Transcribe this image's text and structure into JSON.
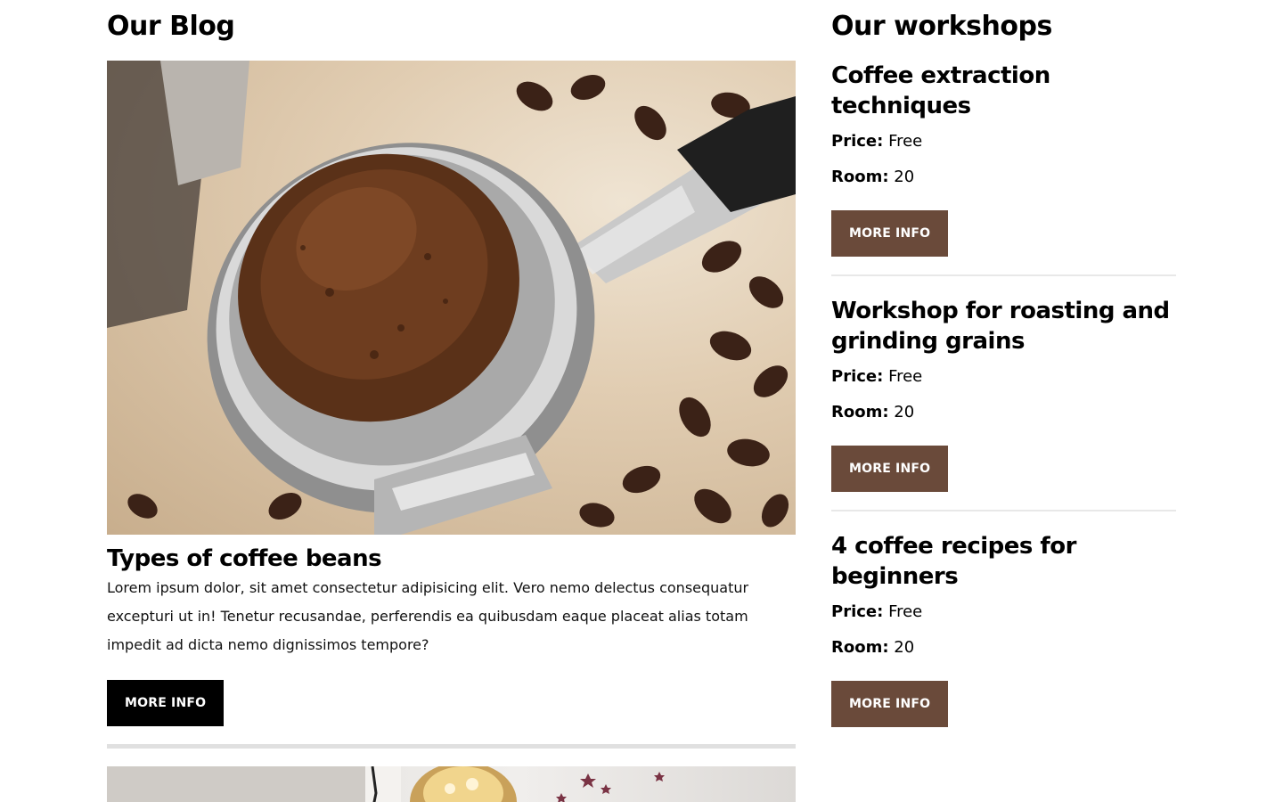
{
  "blog": {
    "title": "Our Blog",
    "posts": [
      {
        "image_alt": "coffee-portafilter-image",
        "title": "Types of coffee beans",
        "excerpt": "Lorem ipsum dolor, sit amet consectetur adipisicing elit. Vero nemo delectus consequatur excepturi ut in! Tenetur recusandae, perferendis ea quibusdam eaque placeat alias totam impedit ad dicta nemo dignissimos tempore?",
        "button_label": "MORE INFO"
      }
    ],
    "next_post_image_alt": "cupcake-image"
  },
  "workshops": {
    "title": "Our workshops",
    "items": [
      {
        "title": "Coffee extraction techniques",
        "price_label": "Price:",
        "price": "Free",
        "room_label": "Room:",
        "room": "20",
        "button_label": "MORE INFO"
      },
      {
        "title": "Workshop for roasting and grinding grains",
        "price_label": "Price:",
        "price": "Free",
        "room_label": "Room:",
        "room": "20",
        "button_label": "MORE INFO"
      },
      {
        "title": "4 coffee recipes for beginners",
        "price_label": "Price:",
        "price": "Free",
        "room_label": "Room:",
        "room": "20",
        "button_label": "MORE INFO"
      }
    ]
  },
  "colors": {
    "button_dark": "#000000",
    "button_brown": "#6a4a3a",
    "divider": "#e0e0e0"
  }
}
